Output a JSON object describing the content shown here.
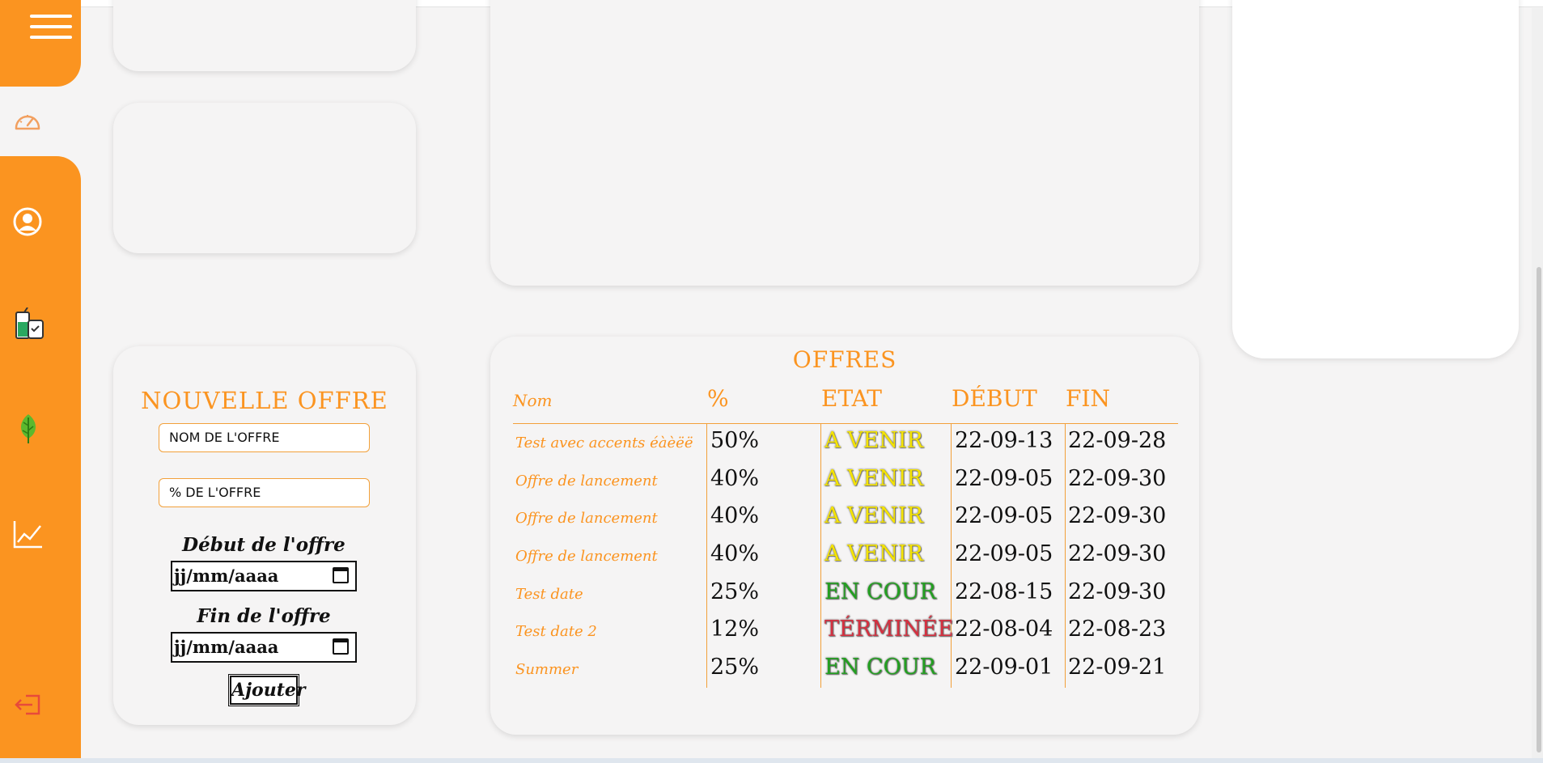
{
  "sidebar": {
    "icons": [
      "menu-icon",
      "dashboard-gauge-icon",
      "user-icon",
      "drinks-icon",
      "leaf-icon",
      "chart-line-icon",
      "logout-icon"
    ]
  },
  "new_offer": {
    "title": "NOUVELLE OFFRE",
    "name_placeholder": "NOM DE L'OFFRE",
    "percent_placeholder": "% DE L'OFFRE",
    "start_label": "Début de l'offre",
    "start_value": "jj/mm/aaaa",
    "end_label": "Fin de l'offre",
    "end_value": "jj/mm/aaaa",
    "submit_label": "Ajouter"
  },
  "offers": {
    "title": "OFFRES",
    "headers": [
      "Nom",
      "%",
      "ETAT",
      "DÉBUT",
      "FIN"
    ],
    "status_colors": {
      "A VENIR": "#f4e300",
      "EN COUR": "#22a020",
      "TÉRMINÉE": "#d63040"
    },
    "rows": [
      {
        "name": "Test avec accents éàèëë",
        "pct": "50%",
        "etat": "A VENIR",
        "debut": "22-09-13",
        "fin": "22-09-28"
      },
      {
        "name": "Offre de lancement",
        "pct": "40%",
        "etat": "A VENIR",
        "debut": "22-09-05",
        "fin": "22-09-30"
      },
      {
        "name": "Offre de lancement",
        "pct": "40%",
        "etat": "A VENIR",
        "debut": "22-09-05",
        "fin": "22-09-30"
      },
      {
        "name": "Offre de lancement",
        "pct": "40%",
        "etat": "A VENIR",
        "debut": "22-09-05",
        "fin": "22-09-30"
      },
      {
        "name": "Test date",
        "pct": "25%",
        "etat": "EN COUR",
        "debut": "22-08-15",
        "fin": "22-09-30"
      },
      {
        "name": "Test date 2",
        "pct": "12%",
        "etat": "TÉRMINÉE",
        "debut": "22-08-04",
        "fin": "22-08-23"
      },
      {
        "name": "Summer",
        "pct": "25%",
        "etat": "EN COUR",
        "debut": "22-09-01",
        "fin": "22-09-21"
      }
    ]
  }
}
